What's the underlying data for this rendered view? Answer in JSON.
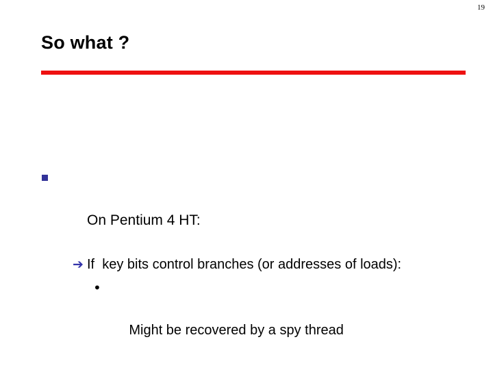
{
  "slide": {
    "page_number": "19",
    "title": "So what ?",
    "accent_color": "#ee1111",
    "divider": {
      "name": "red-horizontal-rule",
      "color": "#ee1111"
    },
    "bullets": [
      {
        "level": 1,
        "marker_glyph": "§",
        "marker_icon": "square-bullet-icon",
        "marker_color": "#333399",
        "text": "On Pentium 4 HT:"
      },
      {
        "level": 2,
        "marker_glyph": "➔",
        "marker_icon": "arrow-right-bullet-icon",
        "marker_color": "#3333aa",
        "text": "If  key bits control branches (or addresses of loads):"
      },
      {
        "level": 3,
        "marker_glyph": "•",
        "marker_icon": "round-bullet-icon",
        "marker_color": "#000000",
        "text": "Might be recovered by a spy thread"
      }
    ]
  }
}
